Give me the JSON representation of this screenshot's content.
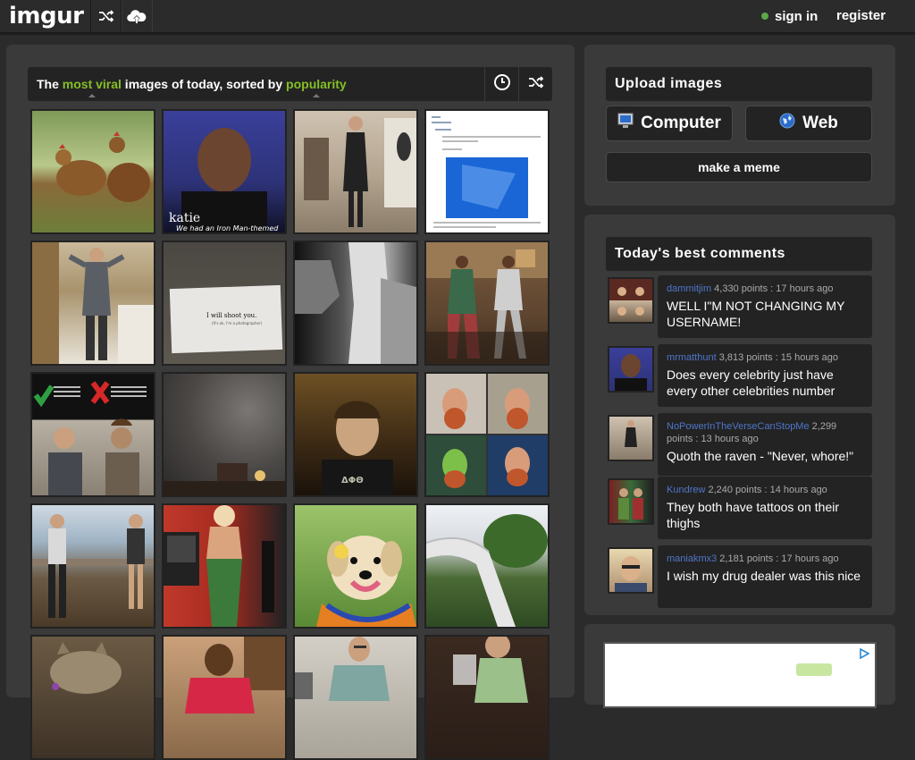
{
  "app": {
    "logo": "imgur",
    "sign_in": "sign in",
    "register": "register"
  },
  "icons": {
    "random": "shuffle-icon",
    "upload": "cloud-upload-icon",
    "time": "clock-icon",
    "shuffle": "shuffle-icon"
  },
  "colors": {
    "accent_green": "#85bf25",
    "link_blue": "#4e76c9",
    "panel": "#3a3a3a",
    "header": "#232323"
  },
  "gallery": {
    "title_parts": [
      "The ",
      "most viral",
      " images of today, sorted by ",
      "popularity"
    ],
    "thumbnails": [
      {
        "desc": "chickens"
      },
      {
        "desc": "man-tv"
      },
      {
        "desc": "man-dress"
      },
      {
        "desc": "text-screenshot"
      },
      {
        "desc": "kitchen-man"
      },
      {
        "desc": "card"
      },
      {
        "desc": "bw-photo"
      },
      {
        "desc": "dancers"
      },
      {
        "desc": "meme-chart"
      },
      {
        "desc": "dark-room"
      },
      {
        "desc": "man-bed"
      },
      {
        "desc": "painting-grid"
      },
      {
        "desc": "deck-people"
      },
      {
        "desc": "mermaid"
      },
      {
        "desc": "puppy"
      },
      {
        "desc": "slide"
      },
      {
        "desc": "cat"
      },
      {
        "desc": "woman"
      },
      {
        "desc": "man-shirt"
      },
      {
        "desc": "man-bag"
      }
    ]
  },
  "upload": {
    "heading": "Upload images",
    "computer": "Computer",
    "web": "Web",
    "meme": "make a meme"
  },
  "comments": {
    "heading": "Today's best comments",
    "items": [
      {
        "user": "dammitjim",
        "meta": " 4,330 points : 17 hours ago",
        "text": "WELL I\"M NOT CHANGING MY USERNAME!"
      },
      {
        "user": "mrmatthunt",
        "meta": " 3,813 points : 15 hours ago",
        "text": "Does every celebrity just have every other celebrities number"
      },
      {
        "user": "NoPowerInTheVerseCanStopMe",
        "meta": " 2,299 points : 13 hours ago",
        "text": "Quoth the raven - \"Never, whore!\""
      },
      {
        "user": "Kundrew",
        "meta": " 2,240 points : 14 hours ago",
        "text": "They both have tattoos on their thighs"
      },
      {
        "user": "maniakmx3",
        "meta": " 2,181 points : 17 hours ago",
        "text": "I wish my drug dealer was this nice"
      }
    ]
  }
}
